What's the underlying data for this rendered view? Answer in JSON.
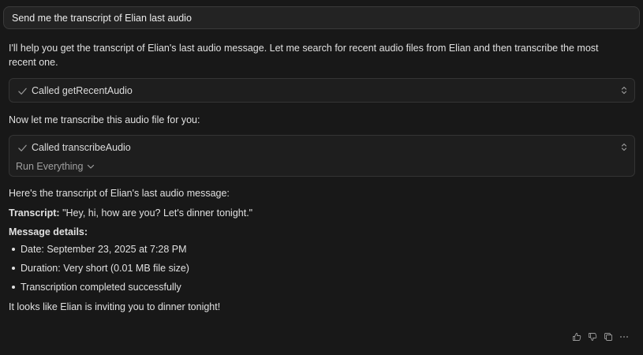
{
  "user_message": "Send me the transcript of Elian last audio",
  "assistant": {
    "intro": "I'll help you get the transcript of Elian's last audio message. Let me search for recent audio files from Elian and then transcribe the most recent one.",
    "tool_call_1": "Called getRecentAudio",
    "transition": "Now let me transcribe this audio file for you:",
    "tool_call_2": "Called transcribeAudio",
    "run_everything": "Run Everything",
    "heres_line": "Here's the transcript of Elian's last audio message:",
    "transcript_label": "Transcript:",
    "transcript_text": " \"Hey, hi, how are you? Let's dinner tonight.\"",
    "details_heading": "Message details:",
    "details": [
      "Date: September 23, 2025 at 7:28 PM",
      "Duration: Very short (0.01 MB file size)",
      "Transcription completed successfully"
    ],
    "closing": "It looks like Elian is inviting you to dinner tonight!"
  },
  "icons": {
    "check": "check-icon",
    "expand": "chevron-up-down-icon",
    "chevron": "chevron-down-icon",
    "actions": [
      "thumbs-up-icon",
      "thumbs-down-icon",
      "copy-icon",
      "more-icon"
    ]
  },
  "colors": {
    "background": "#181818",
    "card": "#1e1e1e",
    "text": "#e0e0e0",
    "muted": "#a0a0a0"
  }
}
